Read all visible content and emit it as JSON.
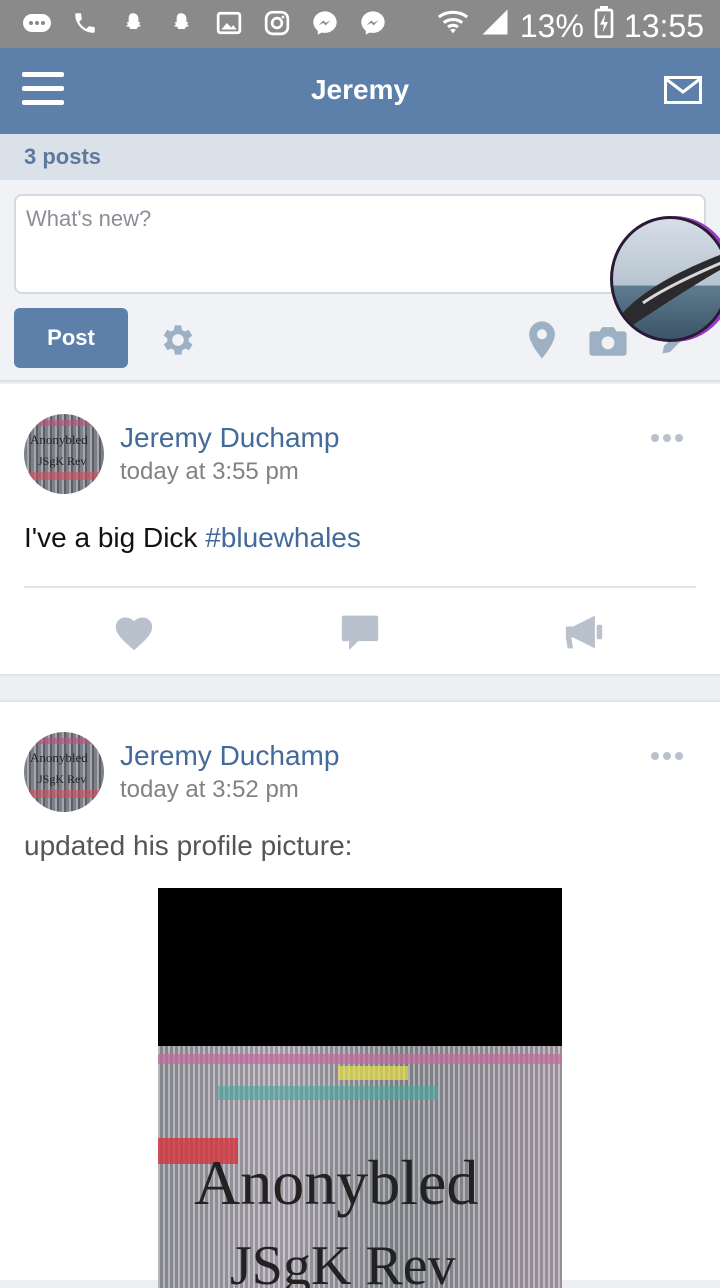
{
  "status_bar": {
    "battery": "13%",
    "time": "13:55",
    "left_icons": [
      "more-icon",
      "phone-icon",
      "snapchat-icon",
      "snapchat-icon",
      "gallery-icon",
      "instagram-icon",
      "messenger-icon",
      "messenger-icon"
    ]
  },
  "header": {
    "title": "Jeremy"
  },
  "posts_count": "3 posts",
  "composer": {
    "placeholder": "What's new?",
    "post_label": "Post"
  },
  "feed": [
    {
      "author": "Jeremy Duchamp",
      "time": "today at 3:55 pm",
      "text": "I've a big Dick ",
      "hashtag": "#bluewhales",
      "avatar_text_1": "Anonybled",
      "avatar_text_2": "JSgK Rev"
    },
    {
      "author": "Jeremy Duchamp",
      "time": "today at 3:52 pm",
      "text": "updated his profile picture:",
      "avatar_text_1": "Anonybled",
      "avatar_text_2": "JSgK Rev",
      "photo_text_1": "Anonybled",
      "photo_text_2": "JSgK Rev"
    }
  ],
  "colors": {
    "accent": "#5d80aa",
    "link": "#436a99",
    "statusbar": "#8a8a8a"
  }
}
